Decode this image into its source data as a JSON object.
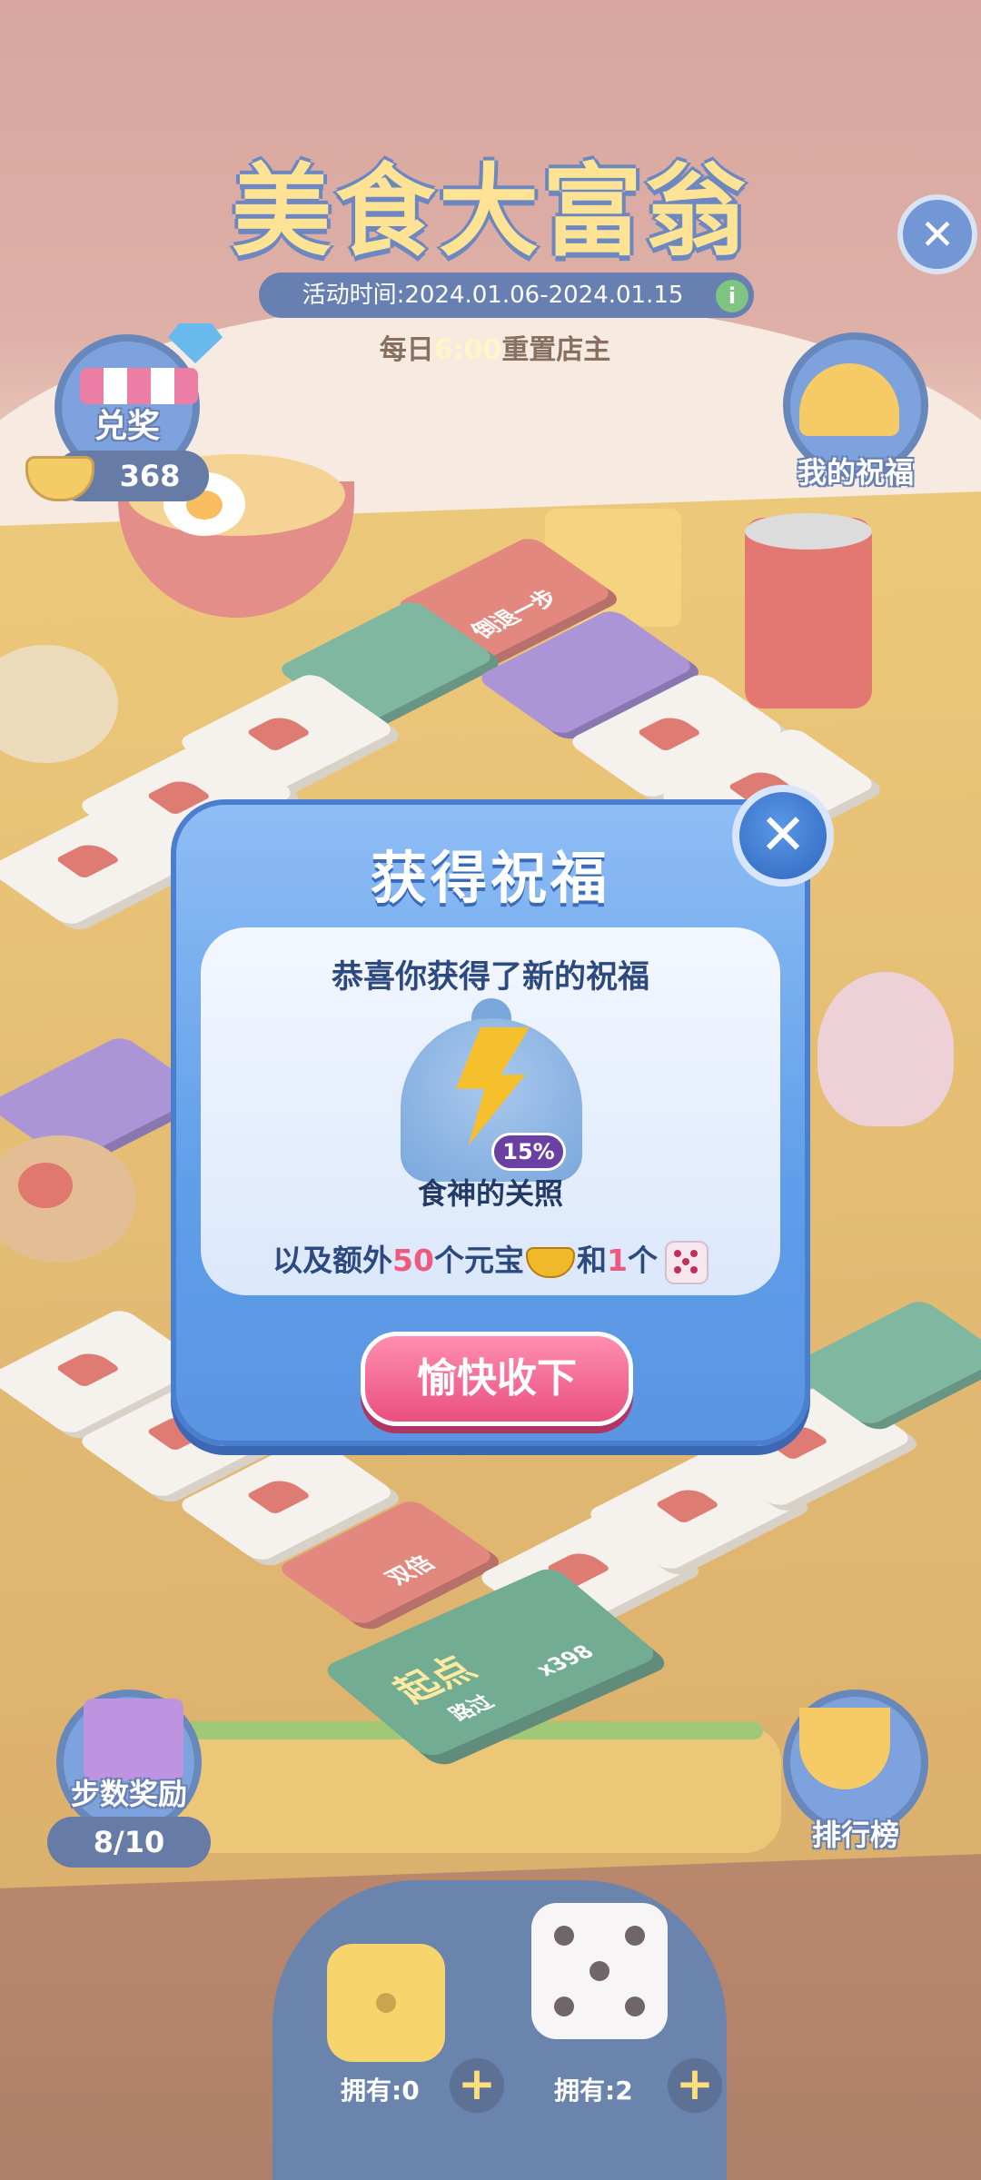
{
  "header": {
    "title": "美食大富翁",
    "activity_time": "活动时间:2024.01.06-2024.01.15",
    "reset_prefix": "每日",
    "reset_time": "6:00",
    "reset_suffix": "重置店主",
    "close_symbol": "✕",
    "info_symbol": "i"
  },
  "left_panel": {
    "exchange_label": "兑奖",
    "ingot_count": "368",
    "step_reward_label": "步数奖励",
    "step_progress": "8/10"
  },
  "right_panel": {
    "my_blessing_label": "我的祝福",
    "leaderboard_label": "排行榜"
  },
  "board": {
    "tile_move_back": "倒退一步",
    "tile_double": "双倍",
    "start_label": "起点",
    "start_pass": "路过",
    "start_reward": "x398"
  },
  "dice_bar": {
    "gold_dice_owned": "拥有:0",
    "normal_dice_owned": "拥有:2",
    "plus_symbol": "+"
  },
  "modal": {
    "title": "获得祝福",
    "congrats": "恭喜你获得了新的祝福",
    "blessing_percent": "15%",
    "blessing_name": "食神的关照",
    "extra_prefix": "以及额外",
    "extra_ingots": "50",
    "extra_ingot_unit": "个元宝",
    "extra_and": "和",
    "extra_dice": "1",
    "extra_dice_unit": "个",
    "accept_label": "愉快收下",
    "close_symbol": "✕"
  },
  "colors": {
    "modal_blue": "#5f9ee9",
    "accept_pink": "#e9507f",
    "highlight_number": "#ee5a7f",
    "title_yellow": "#ffd86b"
  }
}
